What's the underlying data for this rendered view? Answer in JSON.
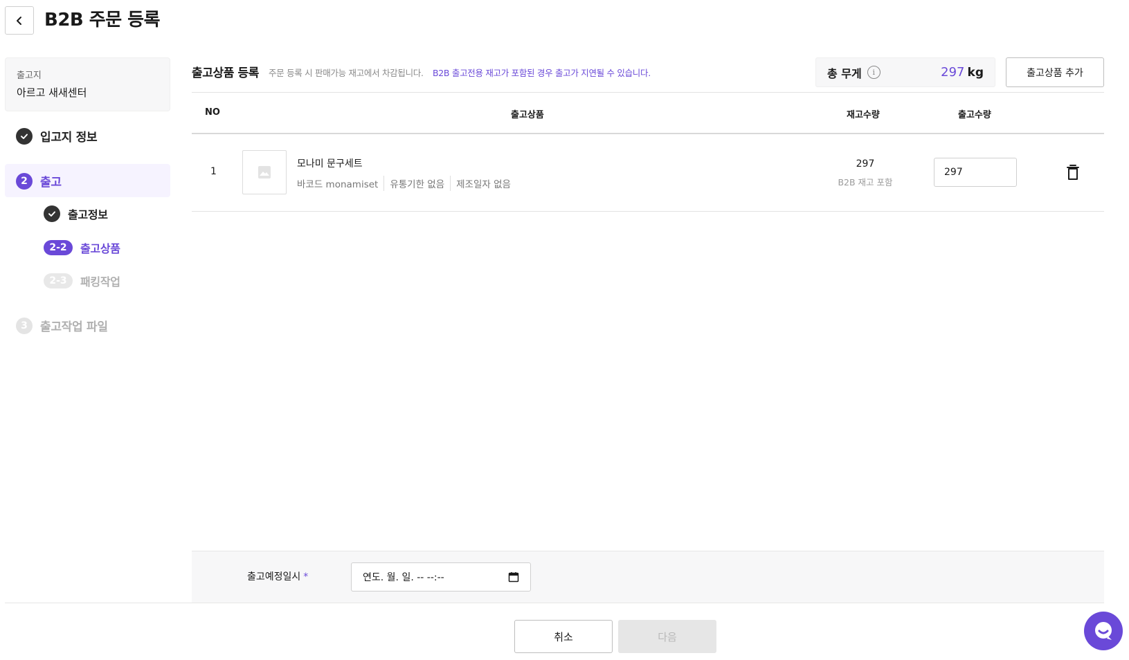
{
  "header": {
    "title": "B2B 주문 등록"
  },
  "sidebar": {
    "warehouse_label": "출고지",
    "warehouse_value": "아르고 새새센터",
    "steps": [
      {
        "number": "1",
        "label": "입고지 정보",
        "state": "done"
      },
      {
        "number": "2",
        "label": "출고",
        "state": "active"
      },
      {
        "number": "3",
        "label": "출고작업 파일",
        "state": "pending"
      }
    ],
    "substeps": [
      {
        "number": "2-1",
        "label": "출고정보",
        "state": "done"
      },
      {
        "number": "2-2",
        "label": "출고상품",
        "state": "active"
      },
      {
        "number": "2-3",
        "label": "패킹작업",
        "state": "pending"
      }
    ]
  },
  "section": {
    "title": "출고상품 등록",
    "note": "주문 등록 시 판매가능 재고에서 차감됩니다.",
    "note_strong": "B2B 출고전용 재고가 포함된 경우 출고가 지연될 수 있습니다.",
    "weight_label": "총 무게",
    "weight_value": "297",
    "weight_unit": "kg",
    "add_button": "출고상품 추가"
  },
  "table": {
    "headers": {
      "no": "NO",
      "product": "출고상품",
      "stock": "재고수량",
      "qty": "출고수량"
    },
    "rows": [
      {
        "no": "1",
        "name": "모나미 문구세트",
        "barcode": "바코드 monamiset",
        "expiry": "유통기한 없음",
        "mfg": "제조일자 없음",
        "stock": "297",
        "stock_note": "B2B 재고 포함",
        "qty": "297"
      }
    ]
  },
  "form": {
    "date_label": "출고예정일시",
    "required_mark": "*",
    "date_placeholder": "연도. 월. 일. -- --:--"
  },
  "footer": {
    "cancel": "취소",
    "next": "다음"
  },
  "colors": {
    "accent": "#6a49d8",
    "done": "#333333",
    "pending": "#e4e4e4"
  },
  "icons": [
    "chevron-left-icon",
    "check-icon",
    "info-icon",
    "image-placeholder-icon",
    "trash-icon",
    "calendar-icon",
    "chat-icon"
  ]
}
